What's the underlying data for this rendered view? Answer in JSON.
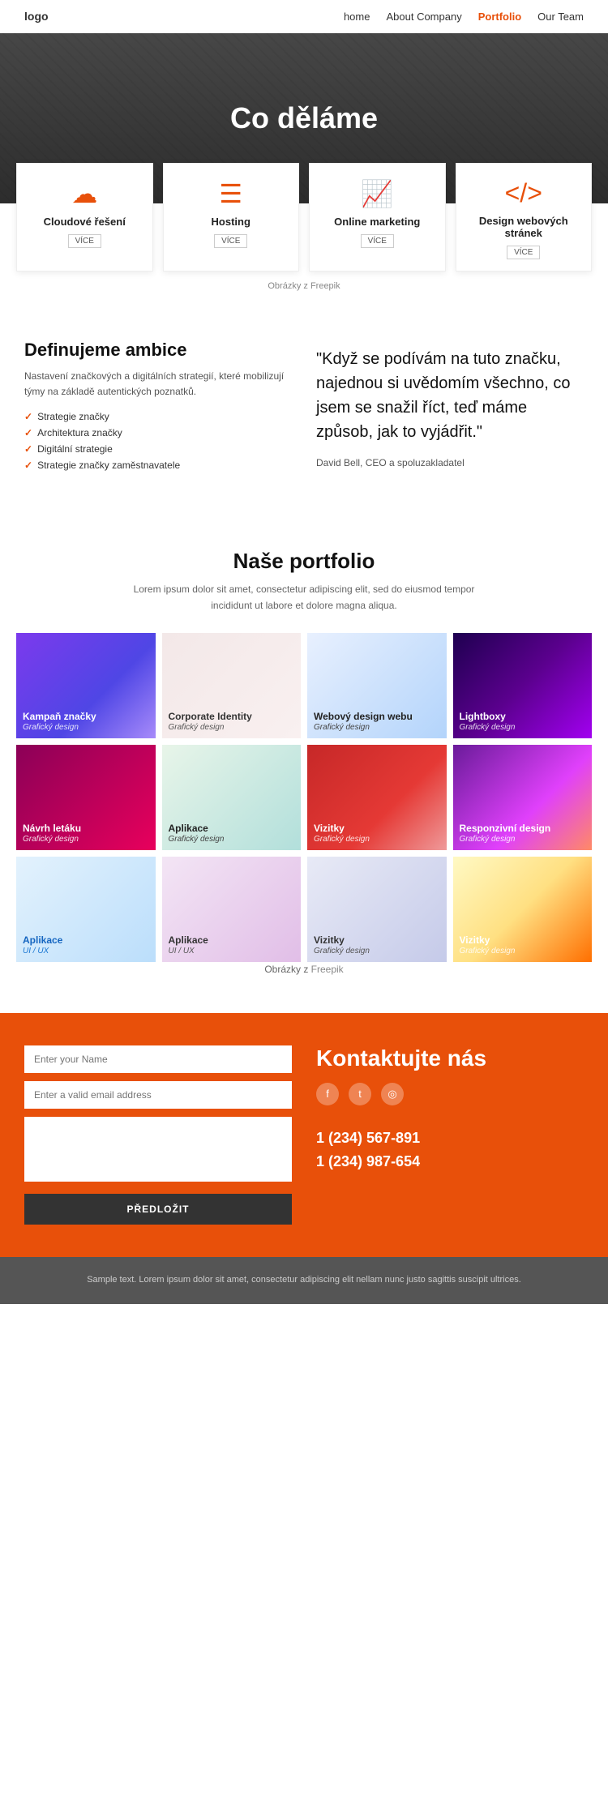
{
  "nav": {
    "logo": "logo",
    "links": [
      {
        "label": "home",
        "active": false
      },
      {
        "label": "About Company",
        "active": false
      },
      {
        "label": "Portfolio",
        "active": true
      },
      {
        "label": "Our Team",
        "active": false
      }
    ]
  },
  "hero": {
    "title": "Co děláme"
  },
  "services": {
    "cards": [
      {
        "icon": "☁",
        "title": "Cloudové řešení",
        "link": "VÍCE"
      },
      {
        "icon": "≡",
        "title": "Hosting",
        "link": "VÍCE"
      },
      {
        "icon": "📊",
        "title": "Online marketing",
        "link": "VÍCE"
      },
      {
        "icon": "</>",
        "title": "Design webových stránek",
        "link": "VÍCE"
      }
    ],
    "freepik_text": "Obrázky z",
    "freepik_link": "Freepik"
  },
  "ambice": {
    "heading": "Definujeme ambice",
    "description": "Nastavení značkových a digitálních strategií, které mobilizují týmy na základě autentických poznatků.",
    "list": [
      "Strategie značky",
      "Architektura značky",
      "Digitální strategie",
      "Strategie značky zaměstnavatele"
    ],
    "quote": "\"Když se podívám na tuto značku, najednou si uvědomím všechno, co jsem se snažil říct, teď máme způsob, jak to vyjádřit.\"",
    "quote_author": "David Bell, CEO a spoluzakladatel"
  },
  "portfolio": {
    "heading": "Naše portfolio",
    "description": "Lorem ipsum dolor sit amet, consectetur adipiscing elit, sed do eiusmod tempor incididunt ut labore et dolore magna aliqua.",
    "items": [
      {
        "name": "Kampaň značky",
        "category": "Grafický design",
        "color_class": "pi-1"
      },
      {
        "name": "Corporate Identity",
        "category": "Grafický design",
        "color_class": "pi-2"
      },
      {
        "name": "Webový design webu",
        "category": "Grafický design",
        "color_class": "pi-3"
      },
      {
        "name": "Lightboxy",
        "category": "Grafický design",
        "color_class": "pi-4"
      },
      {
        "name": "Návrh letáku",
        "category": "Grafický design",
        "color_class": "pi-5"
      },
      {
        "name": "Aplikace",
        "category": "Grafický design",
        "color_class": "pi-6"
      },
      {
        "name": "Vizitky",
        "category": "Grafický design",
        "color_class": "pi-7"
      },
      {
        "name": "Responzivní design",
        "category": "Grafický design",
        "color_class": "pi-8"
      },
      {
        "name": "Aplikace",
        "category": "UI / UX",
        "color_class": "pi-9"
      },
      {
        "name": "Aplikace",
        "category": "UI / UX",
        "color_class": "pi-10"
      },
      {
        "name": "Vizitky",
        "category": "Grafický design",
        "color_class": "pi-11"
      },
      {
        "name": "Vizitky",
        "category": "Grafický design",
        "color_class": "pi-12"
      }
    ],
    "freepik_text": "Obrázky z",
    "freepik_link": "Freepik"
  },
  "contact": {
    "heading": "Kontaktujte nás",
    "name_placeholder": "Enter your Name",
    "email_placeholder": "Enter a valid email address",
    "message_placeholder": "",
    "submit_label": "PŘEDLOŽIT",
    "phone1": "1 (234) 567-891",
    "phone2": "1 (234) 987-654",
    "social": [
      {
        "icon": "f",
        "name": "facebook"
      },
      {
        "icon": "t",
        "name": "twitter"
      },
      {
        "icon": "◎",
        "name": "instagram"
      }
    ]
  },
  "footer": {
    "text": "Sample text. Lorem ipsum dolor sit amet, consectetur adipiscing elit nellam nunc justo sagittis suscipit ultrices."
  }
}
